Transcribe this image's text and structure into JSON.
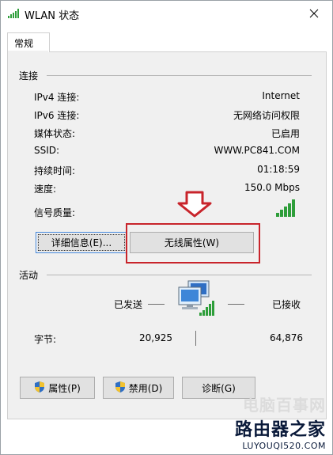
{
  "window": {
    "title": "WLAN 状态",
    "close_label": "✕"
  },
  "tabs": [
    {
      "label": "常规"
    }
  ],
  "connection": {
    "heading": "连接",
    "rows": [
      {
        "label": "IPv4 连接:",
        "value": "Internet"
      },
      {
        "label": "IPv6 连接:",
        "value": "无网络访问权限"
      },
      {
        "label": "媒体状态:",
        "value": "已启用"
      },
      {
        "label": "SSID:",
        "value": "WWW.PC841.COM"
      },
      {
        "label": "持续时间:",
        "value": "01:18:59"
      },
      {
        "label": "速度:",
        "value": "150.0 Mbps"
      }
    ],
    "signal_label": "信号质量:",
    "signal_bars": 5,
    "details_button": "详细信息(E)...",
    "wireless_props_button": "无线属性(W)"
  },
  "activity": {
    "heading": "活动",
    "sent_label": "已发送",
    "received_label": "已接收",
    "bytes_label": "字节:",
    "bytes_sent": "20,925",
    "bytes_received": "64,876"
  },
  "buttons": {
    "properties": "属性(P)",
    "disable": "禁用(D)",
    "diagnose": "诊断(G)"
  },
  "watermark": {
    "top": "电脑百事网",
    "brand": "路由器之家",
    "url": "LUYOUQI520.COM"
  },
  "colors": {
    "highlight": "#c8242b",
    "signal": "#2e9e3a",
    "accent": "#3c7fd4"
  }
}
